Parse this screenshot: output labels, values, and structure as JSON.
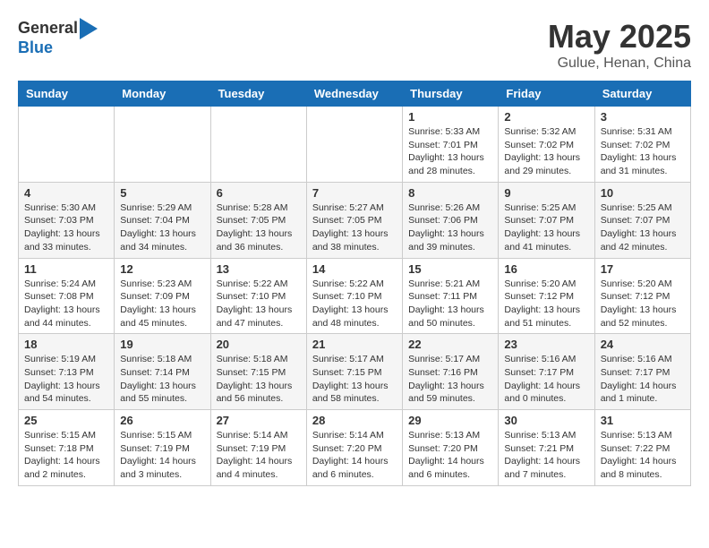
{
  "header": {
    "logo_general": "General",
    "logo_blue": "Blue",
    "month_title": "May 2025",
    "location": "Gulue, Henan, China"
  },
  "weekdays": [
    "Sunday",
    "Monday",
    "Tuesday",
    "Wednesday",
    "Thursday",
    "Friday",
    "Saturday"
  ],
  "weeks": [
    [
      {
        "day": "",
        "info": ""
      },
      {
        "day": "",
        "info": ""
      },
      {
        "day": "",
        "info": ""
      },
      {
        "day": "",
        "info": ""
      },
      {
        "day": "1",
        "info": "Sunrise: 5:33 AM\nSunset: 7:01 PM\nDaylight: 13 hours\nand 28 minutes."
      },
      {
        "day": "2",
        "info": "Sunrise: 5:32 AM\nSunset: 7:02 PM\nDaylight: 13 hours\nand 29 minutes."
      },
      {
        "day": "3",
        "info": "Sunrise: 5:31 AM\nSunset: 7:02 PM\nDaylight: 13 hours\nand 31 minutes."
      }
    ],
    [
      {
        "day": "4",
        "info": "Sunrise: 5:30 AM\nSunset: 7:03 PM\nDaylight: 13 hours\nand 33 minutes."
      },
      {
        "day": "5",
        "info": "Sunrise: 5:29 AM\nSunset: 7:04 PM\nDaylight: 13 hours\nand 34 minutes."
      },
      {
        "day": "6",
        "info": "Sunrise: 5:28 AM\nSunset: 7:05 PM\nDaylight: 13 hours\nand 36 minutes."
      },
      {
        "day": "7",
        "info": "Sunrise: 5:27 AM\nSunset: 7:05 PM\nDaylight: 13 hours\nand 38 minutes."
      },
      {
        "day": "8",
        "info": "Sunrise: 5:26 AM\nSunset: 7:06 PM\nDaylight: 13 hours\nand 39 minutes."
      },
      {
        "day": "9",
        "info": "Sunrise: 5:25 AM\nSunset: 7:07 PM\nDaylight: 13 hours\nand 41 minutes."
      },
      {
        "day": "10",
        "info": "Sunrise: 5:25 AM\nSunset: 7:07 PM\nDaylight: 13 hours\nand 42 minutes."
      }
    ],
    [
      {
        "day": "11",
        "info": "Sunrise: 5:24 AM\nSunset: 7:08 PM\nDaylight: 13 hours\nand 44 minutes."
      },
      {
        "day": "12",
        "info": "Sunrise: 5:23 AM\nSunset: 7:09 PM\nDaylight: 13 hours\nand 45 minutes."
      },
      {
        "day": "13",
        "info": "Sunrise: 5:22 AM\nSunset: 7:10 PM\nDaylight: 13 hours\nand 47 minutes."
      },
      {
        "day": "14",
        "info": "Sunrise: 5:22 AM\nSunset: 7:10 PM\nDaylight: 13 hours\nand 48 minutes."
      },
      {
        "day": "15",
        "info": "Sunrise: 5:21 AM\nSunset: 7:11 PM\nDaylight: 13 hours\nand 50 minutes."
      },
      {
        "day": "16",
        "info": "Sunrise: 5:20 AM\nSunset: 7:12 PM\nDaylight: 13 hours\nand 51 minutes."
      },
      {
        "day": "17",
        "info": "Sunrise: 5:20 AM\nSunset: 7:12 PM\nDaylight: 13 hours\nand 52 minutes."
      }
    ],
    [
      {
        "day": "18",
        "info": "Sunrise: 5:19 AM\nSunset: 7:13 PM\nDaylight: 13 hours\nand 54 minutes."
      },
      {
        "day": "19",
        "info": "Sunrise: 5:18 AM\nSunset: 7:14 PM\nDaylight: 13 hours\nand 55 minutes."
      },
      {
        "day": "20",
        "info": "Sunrise: 5:18 AM\nSunset: 7:15 PM\nDaylight: 13 hours\nand 56 minutes."
      },
      {
        "day": "21",
        "info": "Sunrise: 5:17 AM\nSunset: 7:15 PM\nDaylight: 13 hours\nand 58 minutes."
      },
      {
        "day": "22",
        "info": "Sunrise: 5:17 AM\nSunset: 7:16 PM\nDaylight: 13 hours\nand 59 minutes."
      },
      {
        "day": "23",
        "info": "Sunrise: 5:16 AM\nSunset: 7:17 PM\nDaylight: 14 hours\nand 0 minutes."
      },
      {
        "day": "24",
        "info": "Sunrise: 5:16 AM\nSunset: 7:17 PM\nDaylight: 14 hours\nand 1 minute."
      }
    ],
    [
      {
        "day": "25",
        "info": "Sunrise: 5:15 AM\nSunset: 7:18 PM\nDaylight: 14 hours\nand 2 minutes."
      },
      {
        "day": "26",
        "info": "Sunrise: 5:15 AM\nSunset: 7:19 PM\nDaylight: 14 hours\nand 3 minutes."
      },
      {
        "day": "27",
        "info": "Sunrise: 5:14 AM\nSunset: 7:19 PM\nDaylight: 14 hours\nand 4 minutes."
      },
      {
        "day": "28",
        "info": "Sunrise: 5:14 AM\nSunset: 7:20 PM\nDaylight: 14 hours\nand 6 minutes."
      },
      {
        "day": "29",
        "info": "Sunrise: 5:13 AM\nSunset: 7:20 PM\nDaylight: 14 hours\nand 6 minutes."
      },
      {
        "day": "30",
        "info": "Sunrise: 5:13 AM\nSunset: 7:21 PM\nDaylight: 14 hours\nand 7 minutes."
      },
      {
        "day": "31",
        "info": "Sunrise: 5:13 AM\nSunset: 7:22 PM\nDaylight: 14 hours\nand 8 minutes."
      }
    ]
  ]
}
